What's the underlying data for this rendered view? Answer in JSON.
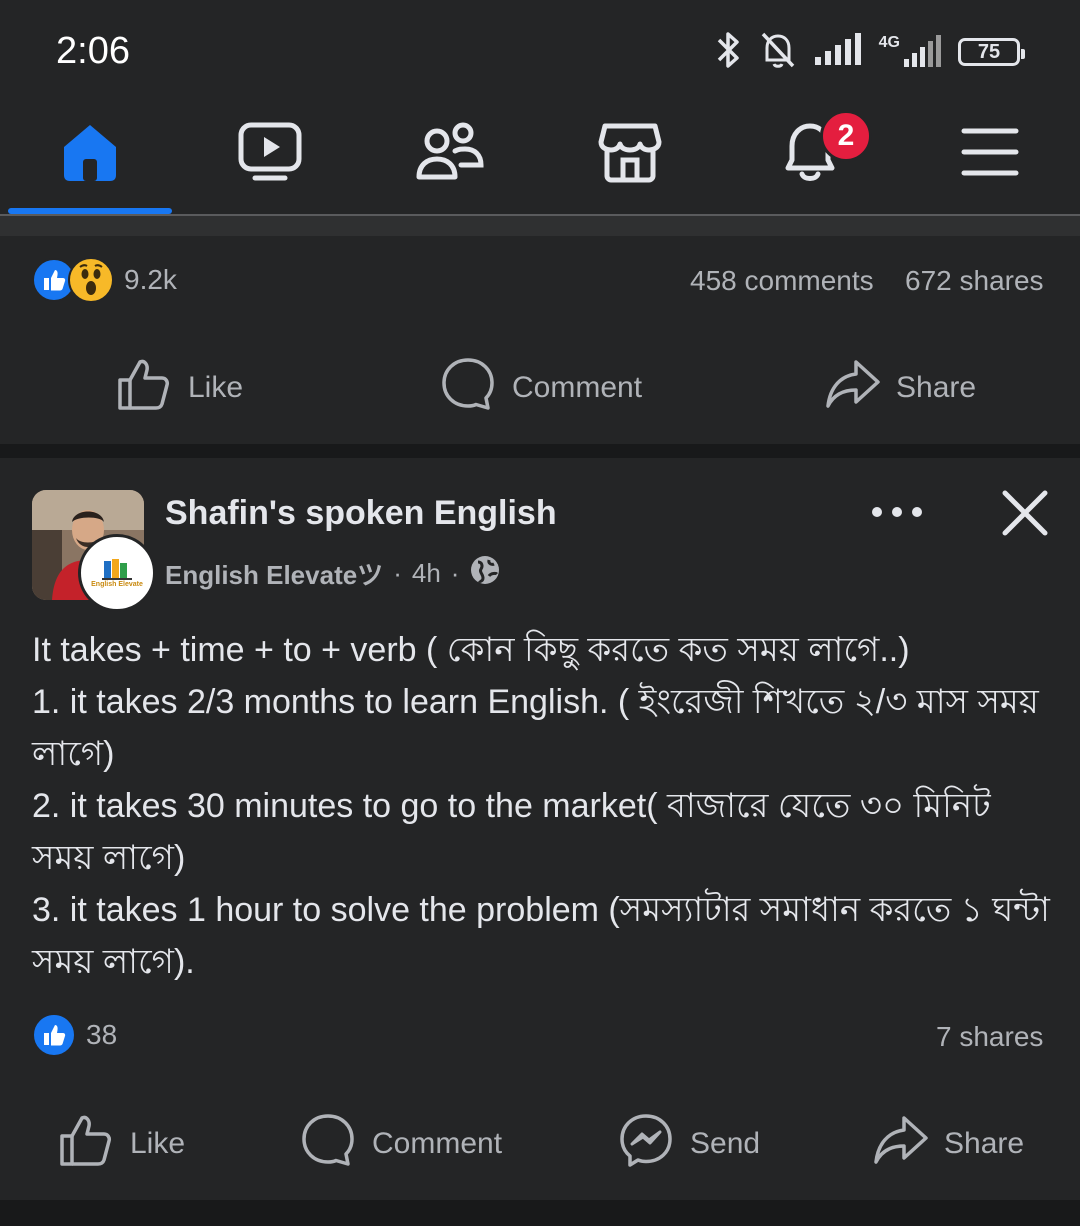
{
  "status_bar": {
    "time": "2:06",
    "network_label": "4G",
    "battery": "75",
    "icons": [
      "bluetooth-icon",
      "bell-off-icon",
      "signal-icon",
      "signal-4g-icon",
      "battery-icon"
    ]
  },
  "nav": {
    "items": [
      {
        "name": "home",
        "icon": "home-icon",
        "active": true
      },
      {
        "name": "video",
        "icon": "video-icon"
      },
      {
        "name": "friends",
        "icon": "friends-icon"
      },
      {
        "name": "marketplace",
        "icon": "marketplace-icon"
      },
      {
        "name": "notifications",
        "icon": "bell-icon",
        "badge": "2"
      },
      {
        "name": "menu",
        "icon": "menu-icon"
      }
    ],
    "accent": "#1877f2"
  },
  "prev_post": {
    "reactions_count": "9.2k",
    "comments": "458 comments",
    "shares": "672 shares",
    "actions": {
      "like": "Like",
      "comment": "Comment",
      "share": "Share"
    }
  },
  "post": {
    "title": "Shafin's spoken English",
    "page_logo_text": "English Elevate",
    "group": "English Elevateツ",
    "dot1": "·",
    "time": "4h",
    "dot2": "·",
    "body": [
      "It takes + time + to + verb ( কোন কিছু করতে কত সময় লাগে..)",
      "1. it takes 2/3 months to learn English. ( ইংরেজী শিখতে ২/৩ মাস সময় লাগে)",
      "2. it takes 30 minutes to go to the market( বাজারে যেতে ৩০ মিনিট সময় লাগে)",
      "3. it takes 1 hour to solve the problem (সমস্যাটার সমাধান করতে ১ ঘন্টা সময় লাগে)."
    ],
    "reactions_count": "38",
    "shares": "7 shares",
    "actions": {
      "like": "Like",
      "comment": "Comment",
      "send": "Send",
      "share": "Share"
    }
  }
}
